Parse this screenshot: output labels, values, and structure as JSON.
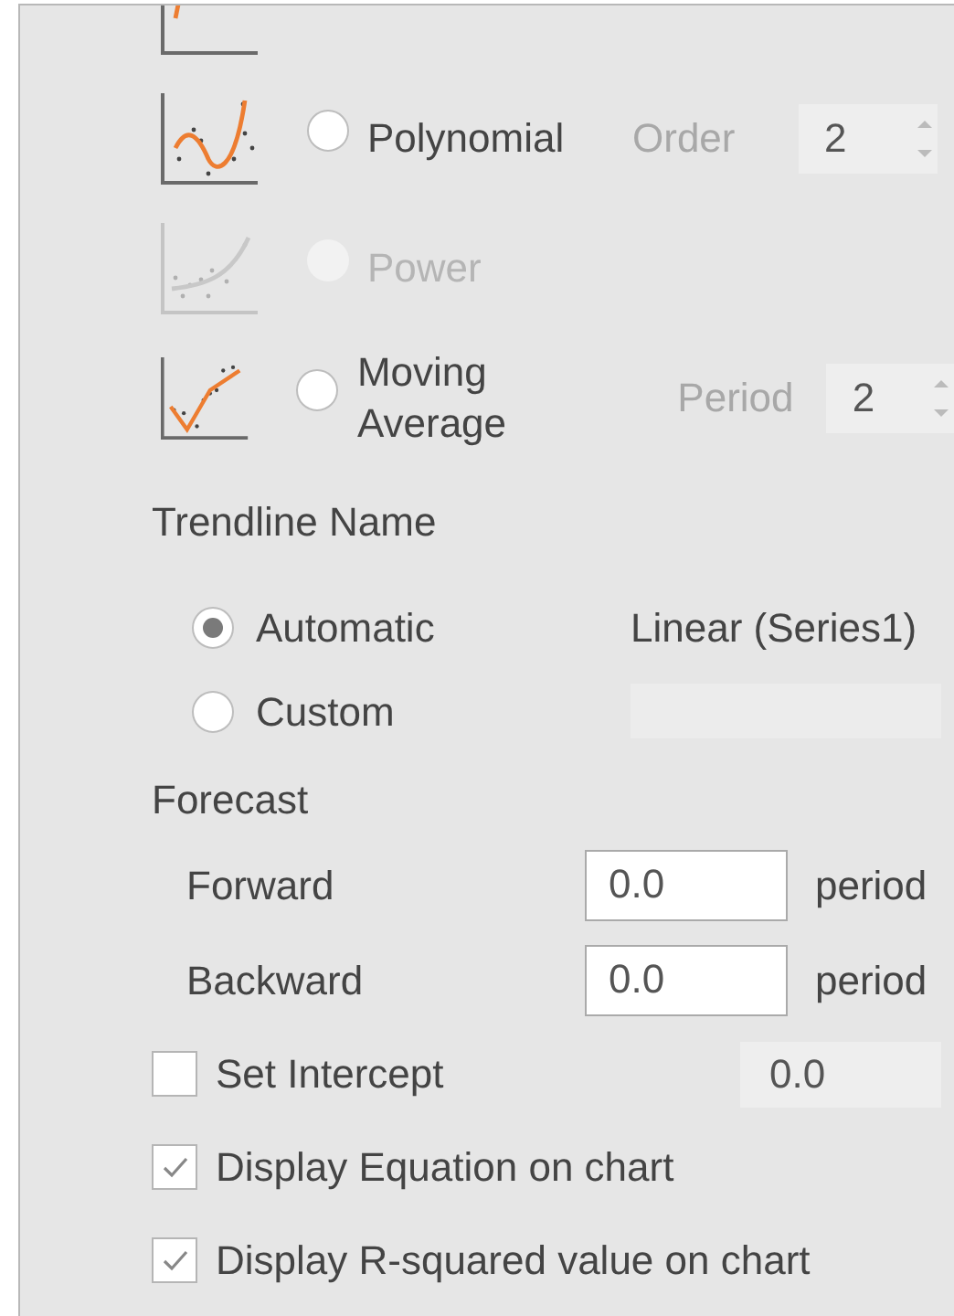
{
  "trend_types": [
    {
      "kind": "polynomial",
      "label": "Polynomial",
      "selected": false,
      "disabled": false,
      "parameter": {
        "label": "Order",
        "value": "2",
        "disabled": true
      }
    },
    {
      "kind": "power",
      "label": "Power",
      "selected": false,
      "disabled": true
    },
    {
      "kind": "moving_average",
      "label": "Moving Average",
      "selected": false,
      "disabled": false,
      "parameter": {
        "label": "Period",
        "value": "2",
        "disabled": true
      }
    }
  ],
  "trendline_name": {
    "title": "Trendline Name",
    "options": [
      {
        "kind": "automatic",
        "label": "Automatic",
        "selected": true,
        "value": "Linear (Series1)"
      },
      {
        "kind": "custom",
        "label": "Custom",
        "selected": false,
        "field_disabled": true
      }
    ]
  },
  "forecast": {
    "title": "Forecast",
    "rows": [
      {
        "label": "Forward",
        "value": "0.0",
        "unit": "period"
      },
      {
        "label": "Backward",
        "value": "0.0",
        "unit": "period"
      }
    ]
  },
  "options": [
    {
      "label": "Set Intercept",
      "checked": false,
      "value": "0.0"
    },
    {
      "label": "Display Equation on chart",
      "checked": true
    },
    {
      "label": "Display R-squared value on chart",
      "checked": true
    }
  ]
}
